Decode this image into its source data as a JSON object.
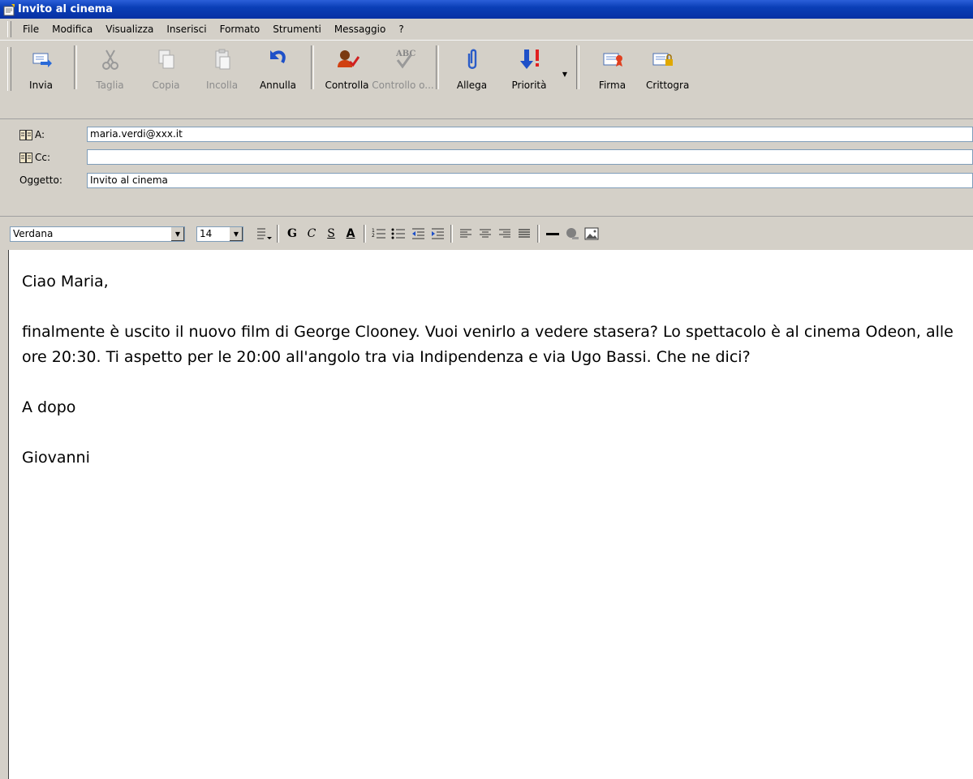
{
  "window": {
    "title": "Invito al cinema"
  },
  "menu": [
    "File",
    "Modifica",
    "Visualizza",
    "Inserisci",
    "Formato",
    "Strumenti",
    "Messaggio",
    "?"
  ],
  "toolbar": {
    "send": "Invia",
    "cut": "Taglia",
    "copy": "Copia",
    "paste": "Incolla",
    "undo": "Annulla",
    "check": "Controlla",
    "spell": "Controllo o...",
    "attach": "Allega",
    "priority": "Priorità",
    "sign": "Firma",
    "encrypt": "Crittogra"
  },
  "fields": {
    "to_label": "A:",
    "to_value": "maria.verdi@xxx.it",
    "cc_label": "Cc:",
    "cc_value": "",
    "subject_label": "Oggetto:",
    "subject_value": "Invito al cinema"
  },
  "format": {
    "font": "Verdana",
    "size": "14",
    "bold": "G",
    "italic": "C",
    "underline": "S",
    "color": "A"
  },
  "body": {
    "greeting": "Ciao Maria,",
    "paragraph": "finalmente è uscito il nuovo film di George Clooney. Vuoi venirlo a vedere stasera? Lo spettacolo è al cinema Odeon, alle ore 20:30. Ti aspetto per le 20:00 all'angolo tra via Indipendenza e via Ugo Bassi. Che ne dici?",
    "closing": "A dopo",
    "signature": "Giovanni"
  }
}
